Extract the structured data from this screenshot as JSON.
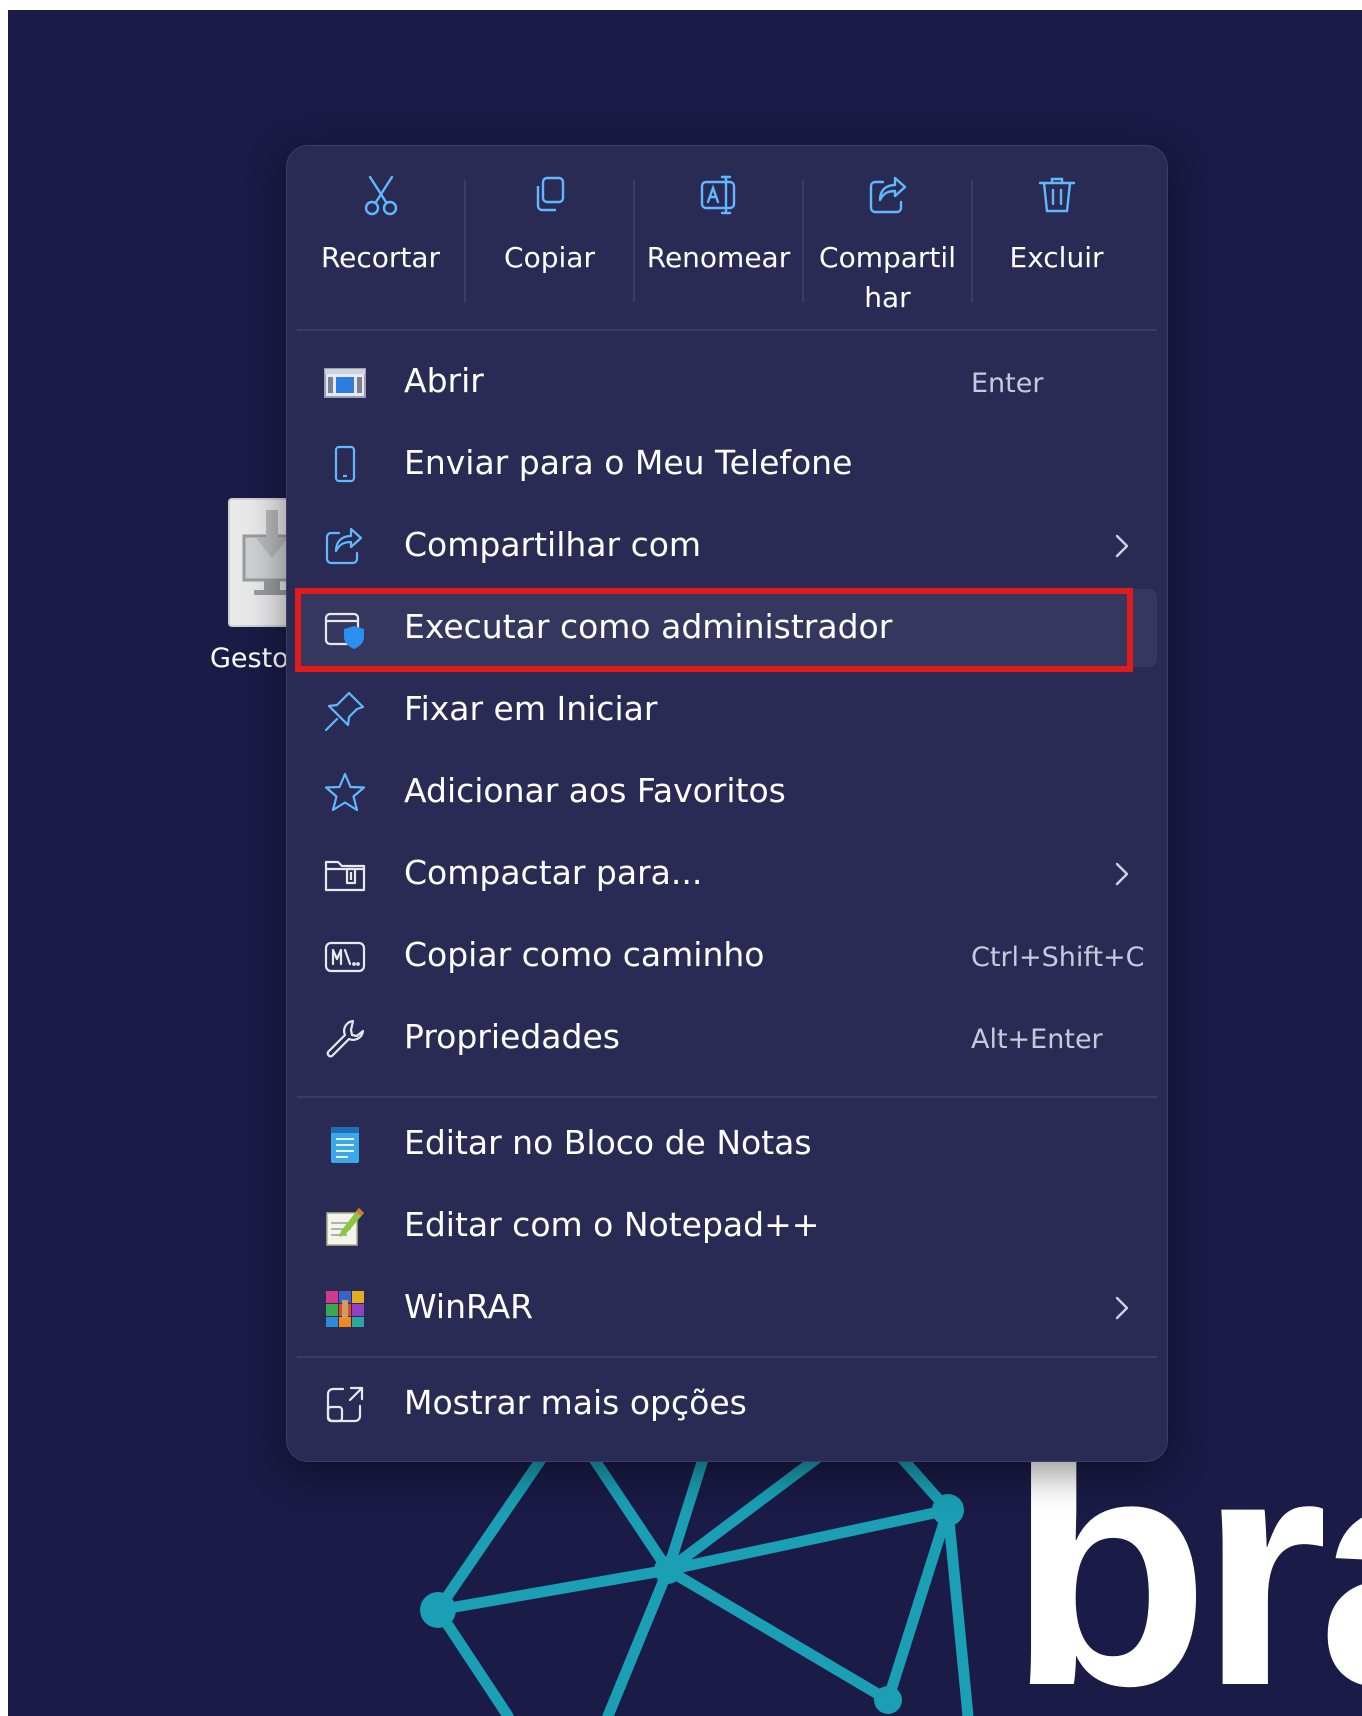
{
  "desktop": {
    "icon_label": "Gestorl",
    "wallpaper_text": "bra"
  },
  "context_menu": {
    "top_actions": [
      {
        "label": "Recortar",
        "icon": "scissors-icon"
      },
      {
        "label": "Copiar",
        "icon": "copy-icon"
      },
      {
        "label": "Renomear",
        "icon": "rename-icon"
      },
      {
        "label": "Compartil\nhar",
        "icon": "share-icon"
      },
      {
        "label": "Excluir",
        "icon": "trash-icon"
      }
    ],
    "items": [
      {
        "label": "Abrir",
        "shortcut": "Enter",
        "icon": "open-window-icon"
      },
      {
        "label": "Enviar para o Meu Telefone",
        "shortcut": "",
        "icon": "phone-icon"
      },
      {
        "label": "Compartilhar com",
        "shortcut": "",
        "icon": "share-icon",
        "submenu": true
      },
      {
        "label": "Executar como administrador",
        "shortcut": "",
        "icon": "shield-admin-icon",
        "highlighted": true
      },
      {
        "label": "Fixar em Iniciar",
        "shortcut": "",
        "icon": "pin-icon"
      },
      {
        "label": "Adicionar aos Favoritos",
        "shortcut": "",
        "icon": "star-icon"
      },
      {
        "label": "Compactar para...",
        "shortcut": "",
        "icon": "zip-folder-icon",
        "submenu": true
      },
      {
        "label": "Copiar como caminho",
        "shortcut": "Ctrl+Shift+C",
        "icon": "path-icon"
      },
      {
        "label": "Propriedades",
        "shortcut": "Alt+Enter",
        "icon": "wrench-icon"
      },
      {
        "label": "Editar no Bloco de Notas",
        "shortcut": "",
        "icon": "notepad-icon"
      },
      {
        "label": "Editar com o Notepad++",
        "shortcut": "",
        "icon": "notepadpp-icon"
      },
      {
        "label": "WinRAR",
        "shortcut": "",
        "icon": "winrar-icon",
        "submenu": true
      },
      {
        "label": "Mostrar mais opções",
        "shortcut": "",
        "icon": "more-options-icon"
      }
    ]
  },
  "colors": {
    "desktop_bg": "#1a1b46",
    "menu_bg": "#2a2b54",
    "accent_blue": "#60b8ff",
    "highlight_border": "#e11b1b",
    "wallpaper_teal": "#1a9fb4"
  }
}
